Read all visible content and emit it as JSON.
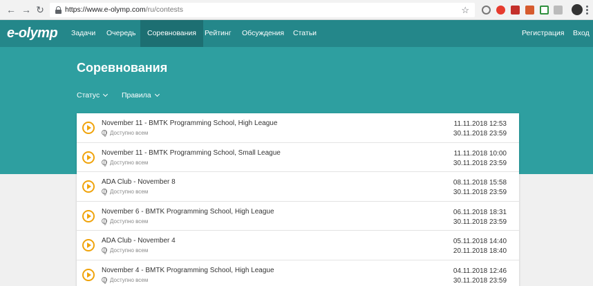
{
  "browser": {
    "url_domain": "https://www.e-olymp.com",
    "url_path": "/ru/contests"
  },
  "nav": {
    "logo": "e-olymp",
    "items": [
      {
        "label": "Задачи"
      },
      {
        "label": "Очередь"
      },
      {
        "label": "Соревнования"
      },
      {
        "label": "Рейтинг"
      },
      {
        "label": "Обсуждения"
      },
      {
        "label": "Статьи"
      }
    ],
    "register": "Регистрация",
    "login": "Вход"
  },
  "page": {
    "title": "Соревнования",
    "filters": [
      {
        "label": "Статус"
      },
      {
        "label": "Правила"
      }
    ]
  },
  "contests": [
    {
      "title": "November 11 - BMTK Programming School, High League",
      "access": "Доступно всем",
      "start": "11.11.2018 12:53",
      "end": "30.11.2018 23:59"
    },
    {
      "title": "November 11 - BMTK Programming School, Small League",
      "access": "Доступно всем",
      "start": "11.11.2018 10:00",
      "end": "30.11.2018 23:59"
    },
    {
      "title": "ADA Club - November 8",
      "access": "Доступно всем",
      "start": "08.11.2018 15:58",
      "end": "30.11.2018 23:59"
    },
    {
      "title": "November 6 - BMTK Programming School, High League",
      "access": "Доступно всем",
      "start": "06.11.2018 18:31",
      "end": "30.11.2018 23:59"
    },
    {
      "title": "ADA Club - November 4",
      "access": "Доступно всем",
      "start": "05.11.2018 14:40",
      "end": "20.11.2018 18:40"
    },
    {
      "title": "November 4 - BMTK Programming School, High League",
      "access": "Доступно всем",
      "start": "04.11.2018 12:46",
      "end": "30.11.2018 23:59"
    }
  ],
  "colors": {
    "nav_bg": "#24878a",
    "nav_active": "#1d6f72",
    "hero_bg": "#2e9fa0",
    "accent_play": "#f0a30a"
  }
}
